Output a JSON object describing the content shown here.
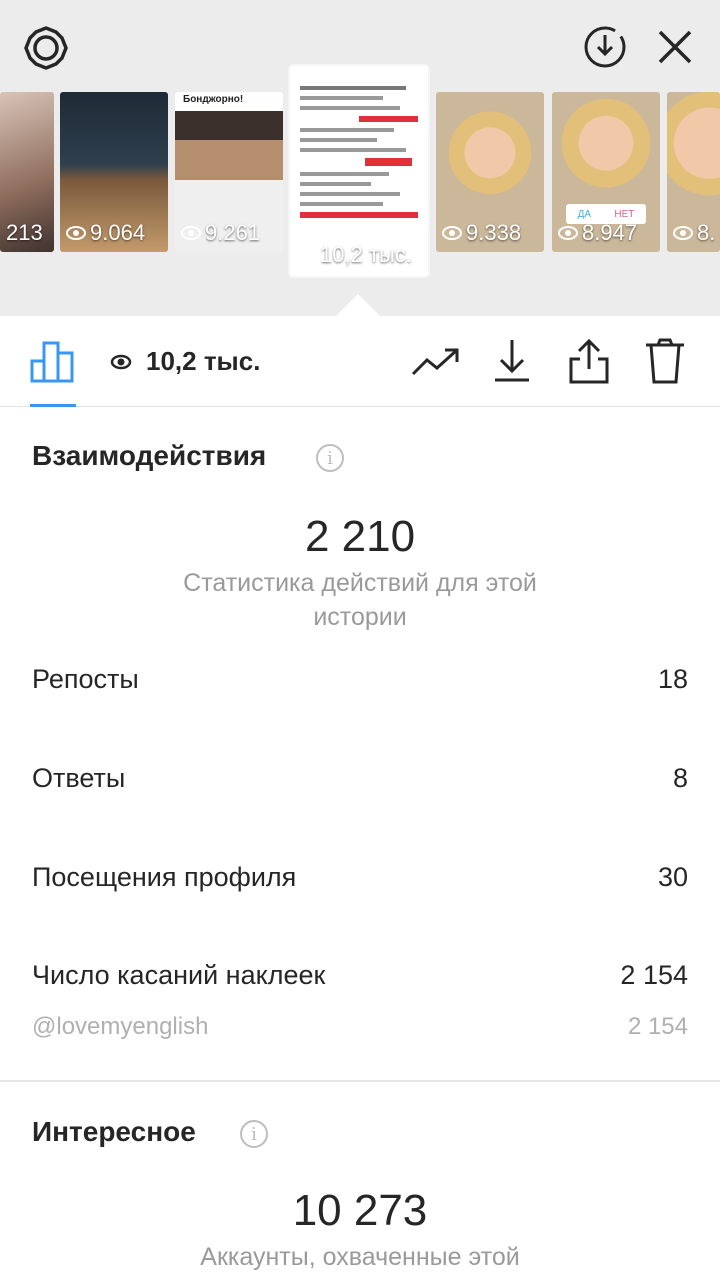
{
  "header": {
    "settings_icon": "gear-icon",
    "download_icon": "download-circle-icon",
    "close_icon": "close-icon"
  },
  "thumbnails": [
    {
      "views": "213"
    },
    {
      "views": "9.064"
    },
    {
      "views": "9.261",
      "caption": "Бонджорно!"
    },
    {
      "views": "10,2 тыс.",
      "selected": true
    },
    {
      "views": "9.338"
    },
    {
      "views": "8.947",
      "poll_yes": "ДА",
      "poll_no": "НЕТ"
    },
    {
      "views": "8."
    }
  ],
  "toolbar": {
    "views_count": "10,2 тыс.",
    "stats_icon": "bar-chart-icon",
    "eye_icon": "eye-icon",
    "promote_icon": "trend-icon",
    "save_icon": "download-icon",
    "share_icon": "share-icon",
    "delete_icon": "trash-icon"
  },
  "interactions": {
    "title": "Взаимодействия",
    "total": "2 210",
    "subtitle": "Статистика действий для этой истории",
    "rows": [
      {
        "label": "Репосты",
        "value": "18"
      },
      {
        "label": "Ответы",
        "value": "8"
      },
      {
        "label": "Посещения профиля",
        "value": "30"
      },
      {
        "label": "Число касаний наклеек",
        "value": "2 154"
      }
    ],
    "sticker_detail": {
      "label": "@lovemyenglish",
      "value": "2 154"
    }
  },
  "discovery": {
    "title": "Интересное",
    "total": "10 273",
    "subtitle": "Аккаунты, охваченные этой"
  },
  "colors": {
    "accent": "#3897f0",
    "text": "#262626",
    "muted": "#9a9a9a"
  }
}
